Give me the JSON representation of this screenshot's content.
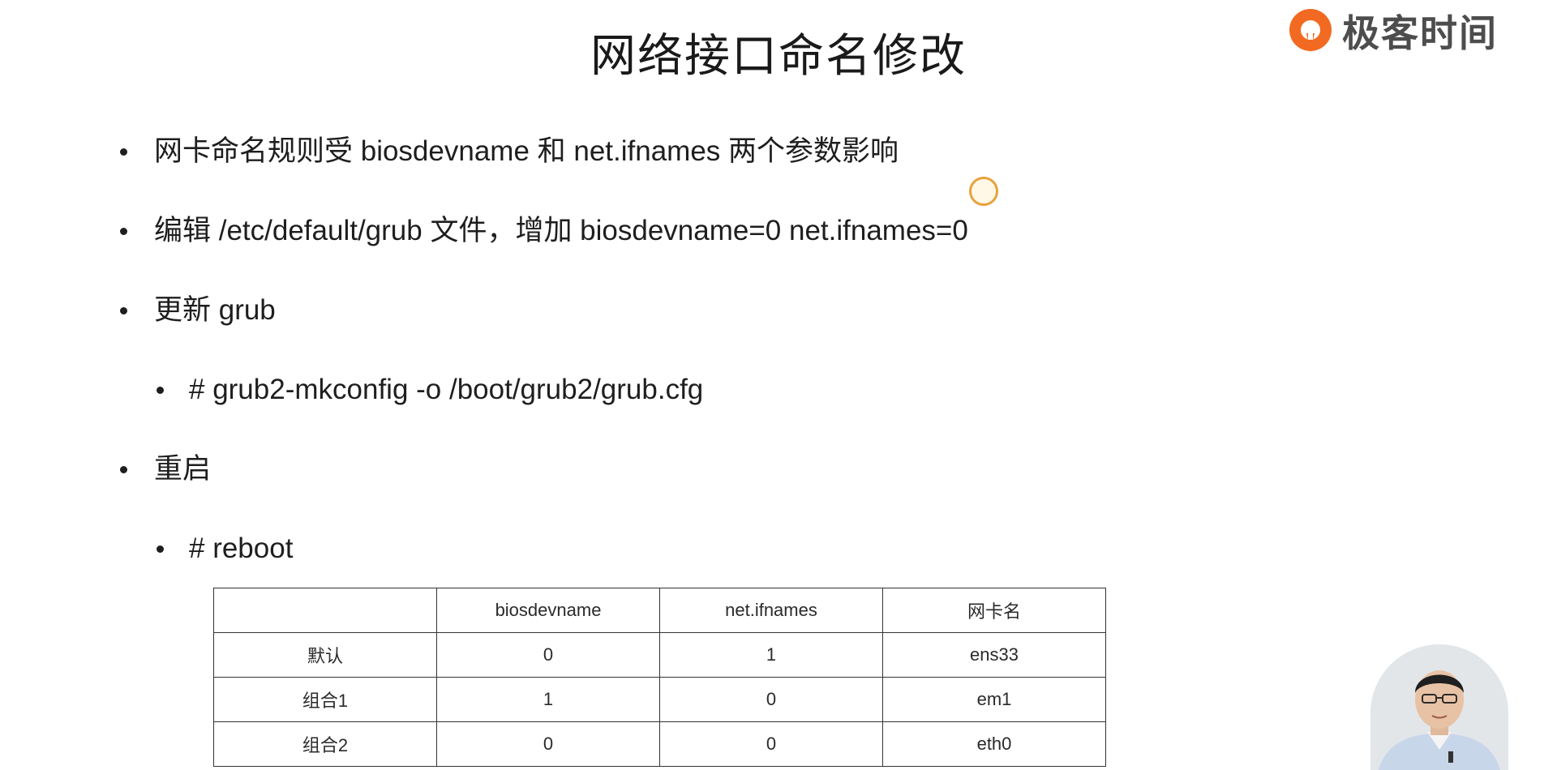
{
  "slide": {
    "title": "网络接口命名修改"
  },
  "brand": {
    "name": "极客时间",
    "logo_icon": "geektime-logo-icon",
    "accent_color": "#f26a21"
  },
  "bullets": [
    {
      "level": 1,
      "text": "网卡命名规则受 biosdevname 和 net.ifnames 两个参数影响"
    },
    {
      "level": 1,
      "text": "编辑 /etc/default/grub 文件，增加 biosdevname=0 net.ifnames=0"
    },
    {
      "level": 1,
      "text": "更新 grub"
    },
    {
      "level": 2,
      "text": "# grub2-mkconfig -o /boot/grub2/grub.cfg"
    },
    {
      "level": 1,
      "text": "重启"
    },
    {
      "level": 2,
      "text": "# reboot"
    }
  ],
  "table": {
    "headers": [
      "",
      "biosdevname",
      "net.ifnames",
      "网卡名"
    ],
    "rows": [
      [
        "默认",
        "0",
        "1",
        "ens33"
      ],
      [
        "组合1",
        "1",
        "0",
        "em1"
      ],
      [
        "组合2",
        "0",
        "0",
        "eth0"
      ]
    ]
  },
  "overlay": {
    "cursor_color": "#e8a23c",
    "presenter_icon": "presenter-webcam"
  }
}
